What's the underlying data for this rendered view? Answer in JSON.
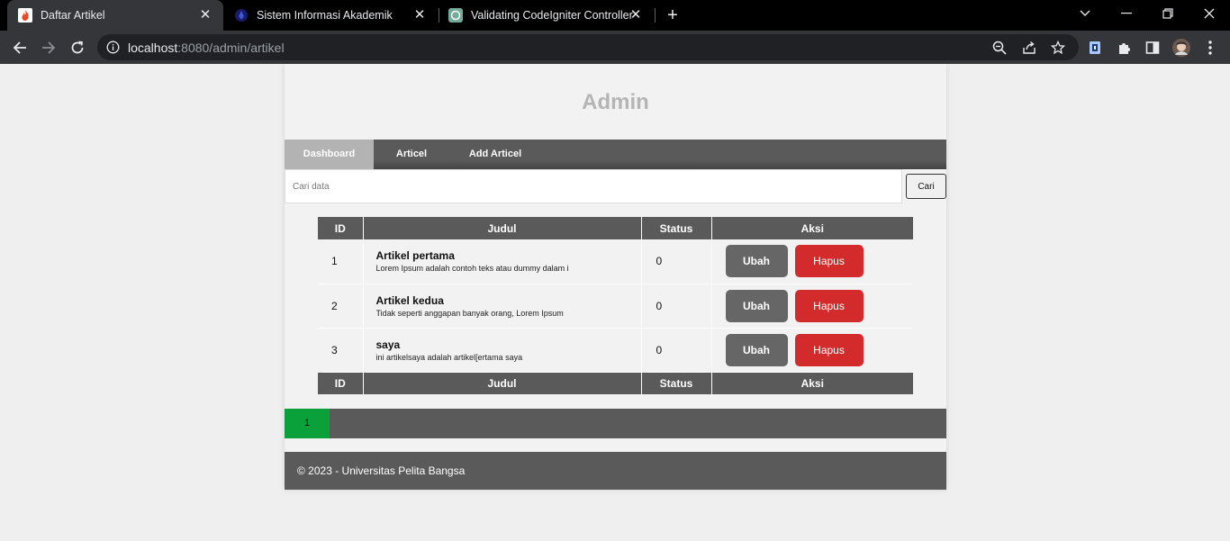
{
  "browser": {
    "tabs": [
      {
        "title": "Daftar Artikel",
        "active": true,
        "icon": "flame-icon"
      },
      {
        "title": "Sistem Informasi Akademik",
        "active": false,
        "icon": "university-logo-icon"
      },
      {
        "title": "Validating CodeIgniter Controller",
        "active": false,
        "icon": "chatgpt-icon"
      }
    ],
    "url_host": "localhost",
    "url_path": ":8080/admin/artikel"
  },
  "header": {
    "title": "Admin"
  },
  "nav": {
    "items": [
      {
        "label": "Dashboard",
        "active": true
      },
      {
        "label": "Articel",
        "active": false
      },
      {
        "label": "Add Articel",
        "active": false
      }
    ]
  },
  "search": {
    "placeholder": "Cari data",
    "value": "",
    "button_label": "Cari"
  },
  "table": {
    "headers": [
      "ID",
      "Judul",
      "Status",
      "Aksi"
    ],
    "rows": [
      {
        "id": "1",
        "title": "Artikel pertama",
        "desc": "Lorem Ipsum adalah contoh teks atau dummy dalam i",
        "status": "0"
      },
      {
        "id": "2",
        "title": "Artikel kedua",
        "desc": "Tidak seperti anggapan banyak orang, Lorem Ipsum",
        "status": "0"
      },
      {
        "id": "3",
        "title": "saya",
        "desc": "ini artikelsaya adalah artikel[ertama saya",
        "status": "0"
      }
    ],
    "edit_label": "Ubah",
    "delete_label": "Hapus"
  },
  "pagination": {
    "pages": [
      "1"
    ],
    "current": "1"
  },
  "footer": {
    "text": "© 2023 - Universitas Pelita Bangsa"
  },
  "colors": {
    "accent_green": "#0aa03a",
    "delete_red": "#d32b2b",
    "nav_gray": "#5a5a5a"
  }
}
